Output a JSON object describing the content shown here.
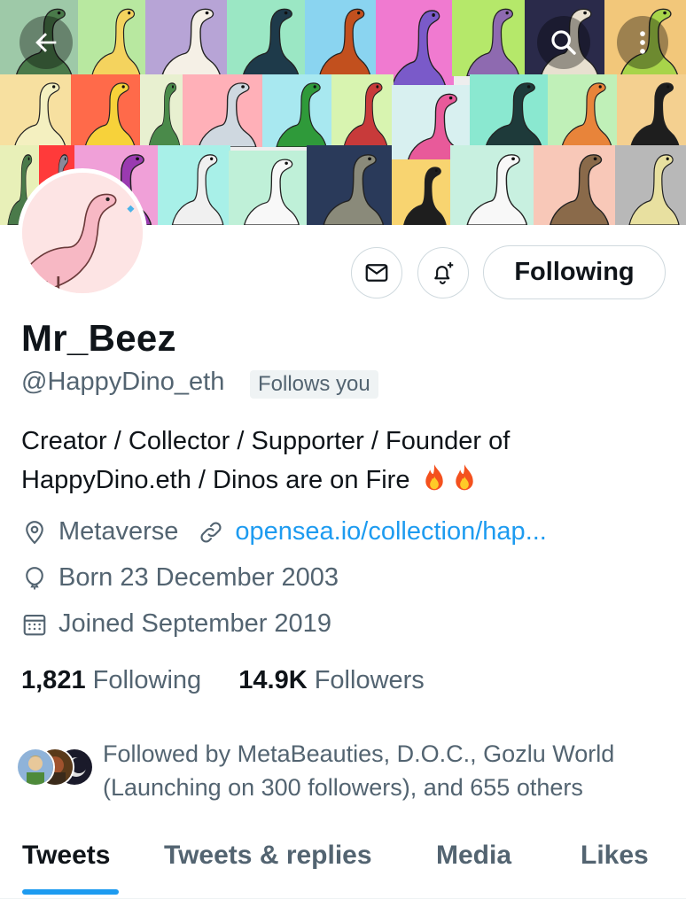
{
  "header": {
    "back_icon": "arrow-left-icon",
    "search_icon": "search-icon",
    "more_icon": "more-vertical-icon"
  },
  "profile": {
    "display_name": "Mr_Beez",
    "handle": "@HappyDino_eth",
    "follows_you_badge": "Follows you",
    "bio": "Creator / Collector / Supporter / Founder of HappyDino.eth / Dinos are on Fire",
    "bio_emoji": "fire-emoji",
    "location": "Metaverse",
    "website": "opensea.io/collection/hap...",
    "birthday": "Born 23 December 2003",
    "joined": "Joined September 2019"
  },
  "actions": {
    "following_label": "Following",
    "message_icon": "mail-icon",
    "notify_icon": "bell-plus-icon"
  },
  "stats": {
    "following_count": "1,821",
    "following_label": "Following",
    "followers_count": "14.9K",
    "followers_label": "Followers"
  },
  "followed_by": {
    "text": "Followed by MetaBeauties, D.O.C., Gozlu World (Launching on 300 followers), and 655 others"
  },
  "tabs": [
    {
      "label": "Tweets",
      "active": true
    },
    {
      "label": "Tweets & replies",
      "active": false
    },
    {
      "label": "Media",
      "active": false
    },
    {
      "label": "Likes",
      "active": false
    }
  ],
  "colors": {
    "accent": "#1d9bf0",
    "text_primary": "#0f1419",
    "text_secondary": "#536471"
  }
}
